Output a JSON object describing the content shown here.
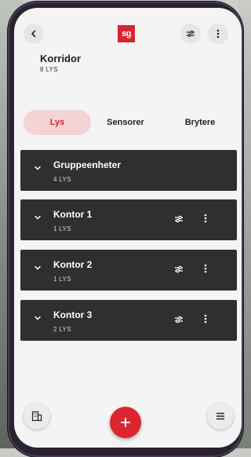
{
  "header": {
    "logo_text": "sg",
    "title": "Korridor",
    "subtitle": "8 LYS"
  },
  "tabs": [
    {
      "label": "Lys",
      "active": true
    },
    {
      "label": "Sensorer",
      "active": false
    },
    {
      "label": "Brytere",
      "active": false
    }
  ],
  "groups": [
    {
      "name": "Gruppeenheter",
      "count": "4 LYS",
      "has_actions": false
    },
    {
      "name": "Kontor 1",
      "count": "1 LYS",
      "has_actions": true
    },
    {
      "name": "Kontor 2",
      "count": "1 LYS",
      "has_actions": true
    },
    {
      "name": "Kontor 3",
      "count": "2 LYS",
      "has_actions": true
    }
  ],
  "icons": {
    "back": "chevron-left-icon",
    "filter": "sliders-icon",
    "more": "more-vertical-icon",
    "expand": "chevron-down-icon",
    "building": "building-icon",
    "add": "plus-icon",
    "menu": "menu-icon"
  },
  "colors": {
    "accent": "#dc2531",
    "tab_active_bg": "#f4d3d6",
    "group_bg": "#2f2f2f",
    "screen_bg": "#f4f4f4"
  }
}
